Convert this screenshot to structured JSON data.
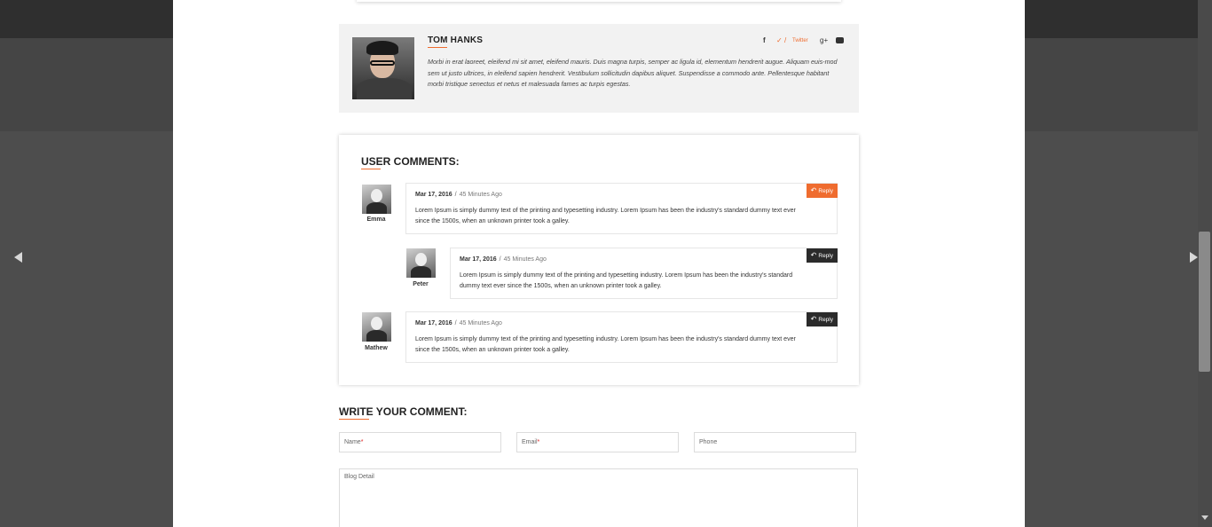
{
  "author": {
    "name": "TOM HANKS",
    "bio": "Morbi in erat laoreet, eleifend mi sit amet, eleifend mauris. Duis magna turpis, semper ac ligula id, elementum hendrerit augue. Aliquam euis-mod sem ut justo ultrices, in eleifend sapien hendrerit. Vestibulum sollicitudin dapibus aliquet. Suspendisse a commodo ante. Pellentesque habitant morbi tristique senectus et netus et malesuada fames ac turpis egestas.",
    "socials": {
      "facebook_glyph": "f",
      "twitter_glyph": "✓",
      "twitter_sep": "/",
      "twitter_label": "Twitter",
      "google_glyph": "g+",
      "youtube_icon": "youtube-icon"
    }
  },
  "comments": {
    "title": "USER COMMENTS:",
    "items": [
      {
        "name": "Emma",
        "date": "Mar 17, 2016",
        "sep": "/",
        "ago": "45 Minutes Ago",
        "text_line1": "Lorem Ipsum is simply dummy text of the printing and typesetting industry. Lorem Ipsum has been the industry's standard dummy text ever",
        "text_line2": "since the 1500s, when an unknown printer took a galley.",
        "reply": "Reply"
      },
      {
        "name": "Peter",
        "date": "Mar 17, 2016",
        "sep": "/",
        "ago": "45 Minutes Ago",
        "text_line1": "Lorem Ipsum is simply dummy text of the printing and typesetting industry. Lorem Ipsum has been the industry's standard",
        "text_line2": "dummy text ever since the 1500s, when an unknown printer took a galley.",
        "reply": "Reply"
      },
      {
        "name": "Mathew",
        "date": "Mar 17, 2016",
        "sep": "/",
        "ago": "45 Minutes Ago",
        "text_line1": "Lorem Ipsum is simply dummy text of the printing and typesetting industry. Lorem Ipsum has been the industry's standard dummy text ever",
        "text_line2": "since the 1500s, when an unknown printer took a galley.",
        "reply": "Reply"
      }
    ]
  },
  "form": {
    "title": "WRITE YOUR COMMENT:",
    "name_placeholder": "Name",
    "email_placeholder": "Email",
    "required_mark": "*",
    "phone_placeholder": "Phone",
    "detail_placeholder": "Blog Detail"
  },
  "colors": {
    "accent": "#ef6c2f",
    "dark_button": "#2b2b2b"
  }
}
